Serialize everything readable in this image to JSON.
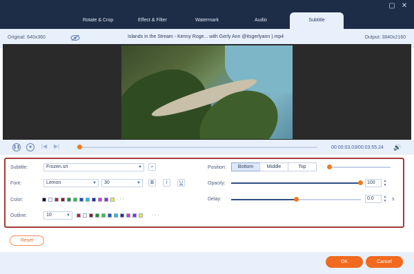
{
  "tabs": [
    {
      "label": "Rotate & Crop"
    },
    {
      "label": "Effect & Filter"
    },
    {
      "label": "Watermark"
    },
    {
      "label": "Audio"
    },
    {
      "label": "Subtitle"
    }
  ],
  "info": {
    "original": "Original: 640x360",
    "filename": "Islands in the Stream - Kenny Roge... with Gerly Ann @itsgerlyann ).mp4",
    "output": "Output: 3840x2160"
  },
  "playback": {
    "timecode": "00:00:03.03/00:03:55.24",
    "progress": 0.01
  },
  "subtitle": {
    "label": "Subtitle:",
    "file": "Frozen.srt"
  },
  "font": {
    "label": "Font:",
    "family": "Lemon",
    "size": "30",
    "bold": "B",
    "italic": "I",
    "underline": "U"
  },
  "color": {
    "label": "Color:",
    "swatches": [
      "#111111",
      "#ffffff",
      "#b3262c",
      "#8a1c1c",
      "#1f8f2e",
      "#3cbf3c",
      "#1d4fb8",
      "#29b7d6",
      "#2a2a9e",
      "#d838c8",
      "#8a2be2",
      "#f2e93c"
    ],
    "more": "· · ·"
  },
  "outline": {
    "label": "Outline:",
    "value": "10",
    "swatches": [
      "#b3262c",
      "#ffffff",
      "#8a1c1c",
      "#1f8f2e",
      "#3cbf3c",
      "#1d4fb8",
      "#29b7d6",
      "#2a2a9e",
      "#d838c8",
      "#8a2be2",
      "#f2e93c"
    ],
    "more": "· · ·"
  },
  "position": {
    "label": "Position:",
    "options": [
      "Bottom",
      "Middle",
      "Top"
    ],
    "selected": "Bottom"
  },
  "opacity": {
    "label": "Opacity:",
    "value": "100"
  },
  "delay": {
    "label": "Delay:",
    "value": "0.0",
    "unit": "s"
  },
  "buttons": {
    "reset": "Reset",
    "ok": "OK",
    "cancel": "Cancel"
  },
  "icons": {
    "close": "close-icon",
    "restore": "restore-icon",
    "eye": "eye-slash-icon",
    "search": "search-icon",
    "volume": "volume-icon"
  }
}
